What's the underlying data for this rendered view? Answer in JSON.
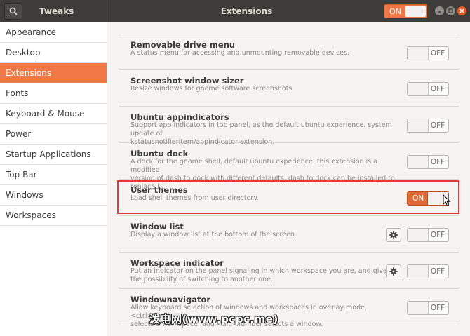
{
  "app": {
    "title": "Tweaks",
    "window_title": "Extensions",
    "master_switch_label": "ON"
  },
  "colors": {
    "accent": "#f07746",
    "header": "#3d3c38",
    "highlight": "#e23a3a"
  },
  "sidebar": {
    "items": [
      {
        "label": "Appearance"
      },
      {
        "label": "Desktop"
      },
      {
        "label": "Extensions",
        "active": true
      },
      {
        "label": "Fonts"
      },
      {
        "label": "Keyboard & Mouse"
      },
      {
        "label": "Power"
      },
      {
        "label": "Startup Applications"
      },
      {
        "label": "Top Bar"
      },
      {
        "label": "Windows"
      },
      {
        "label": "Workspaces"
      }
    ]
  },
  "extensions": [
    {
      "name": "Removable drive menu",
      "desc": "A status menu for accessing and unmounting removable devices.",
      "state": "OFF"
    },
    {
      "name": "Screenshot window sizer",
      "desc": "Resize windows for gnome software screenshots",
      "state": "OFF"
    },
    {
      "name": "Ubuntu appindicators",
      "desc": "Support app indicators in top panel, as the default ubuntu experience. system update of\nkstatusnotifieritem/appindicator extension.",
      "state": "OFF"
    },
    {
      "name": "Ubuntu dock",
      "desc": "A dock for the gnome shell, default ubuntu experience. this extension is a modified\nversion of dash to dock with different defaults. dash to dock can be installed to replace i…",
      "state": "OFF"
    },
    {
      "name": "User themes",
      "desc": "Load shell themes from user directory.",
      "state": "ON"
    },
    {
      "name": "Window list",
      "desc": "Display a window list at the bottom of the screen.",
      "state": "OFF"
    },
    {
      "name": "Workspace indicator",
      "desc": "Put an indicator on the panel signaling in which workspace you are, and give you\nthe possibility of switching to another one.",
      "state": "OFF"
    },
    {
      "name": "Windownavigator",
      "desc": "Allow keyboard selection of windows and workspaces in overlay mode. <ctrl>number\nselects a workspace, and <alt>number selects a window.",
      "state": "OFF"
    }
  ],
  "watermark": "泼电网(www.pcpc.me)"
}
